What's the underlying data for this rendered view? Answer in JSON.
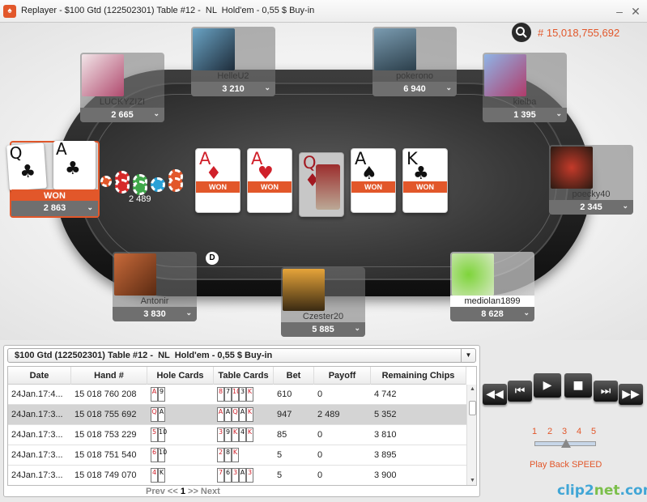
{
  "window": {
    "title": "Replayer - $100 Gtd (122502301) Table #12 -  NL  Hold'em - 0,55 $ Buy-in"
  },
  "hand_number": "# 15,018,755,692",
  "pot": "2 489",
  "dealer_button": "D",
  "colors": {
    "accent": "#e2572a",
    "won": "#e2572a"
  },
  "players": [
    {
      "name": "HelleU2",
      "stack": "3 210"
    },
    {
      "name": "pokerono",
      "stack": "6 940"
    },
    {
      "name": "LUCKYZIZI",
      "stack": "2 665"
    },
    {
      "name": "kielba",
      "stack": "1 395"
    },
    {
      "name": "poecky40",
      "stack": "2 345"
    },
    {
      "name": "Antonir",
      "stack": "3 830"
    },
    {
      "name": "Czester20",
      "stack": "5 885"
    },
    {
      "name": "mediolan1899",
      "stack": "8 628"
    }
  ],
  "winner": {
    "status": "WON",
    "stack": "2 863",
    "cards": [
      {
        "rank": "Q",
        "suit": "♣"
      },
      {
        "rank": "A",
        "suit": "♣"
      }
    ]
  },
  "board": [
    {
      "rank": "A",
      "suit": "♦",
      "won": "WON"
    },
    {
      "rank": "A",
      "suit": "♥",
      "won": "WON"
    },
    {
      "rank": "Q",
      "suit": "♦",
      "won": ""
    },
    {
      "rank": "A",
      "suit": "♠",
      "won": "WON"
    },
    {
      "rank": "K",
      "suit": "♣",
      "won": "WON"
    }
  ],
  "hand_list": {
    "selector": "$100 Gtd (122502301) Table #12 -  NL  Hold'em - 0,55 $ Buy-in",
    "columns": [
      "Date",
      "Hand #",
      "Hole Cards",
      "Table Cards",
      "Bet",
      "Payoff",
      "Remaining Chips"
    ],
    "rows": [
      {
        "date": "24Jan.17:4...",
        "hand": "15 018 760 208",
        "hole": [
          "A",
          "9"
        ],
        "table": [
          "8",
          "7",
          "10",
          "3",
          "K"
        ],
        "bet": "610",
        "payoff": "0",
        "remaining": "4 742"
      },
      {
        "date": "24Jan.17:3...",
        "hand": "15 018 755 692",
        "hole": [
          "Q",
          "A"
        ],
        "table": [
          "A",
          "A",
          "Q",
          "A",
          "K"
        ],
        "bet": "947",
        "payoff": "2 489",
        "remaining": "5 352"
      },
      {
        "date": "24Jan.17:3...",
        "hand": "15 018 753 229",
        "hole": [
          "5",
          "10"
        ],
        "table": [
          "3",
          "9",
          "K",
          "4",
          "K"
        ],
        "bet": "85",
        "payoff": "0",
        "remaining": "3 810"
      },
      {
        "date": "24Jan.17:3...",
        "hand": "15 018 751 540",
        "hole": [
          "6",
          "10"
        ],
        "table": [
          "2",
          "8",
          "K"
        ],
        "bet": "5",
        "payoff": "0",
        "remaining": "3 895"
      },
      {
        "date": "24Jan.17:3...",
        "hand": "15 018 749 070",
        "hole": [
          "4",
          "K"
        ],
        "table": [
          "7",
          "6",
          "3",
          "A",
          "3"
        ],
        "bet": "5",
        "payoff": "0",
        "remaining": "3 900"
      }
    ],
    "pager": {
      "prev": "Prev <<",
      "page": "1",
      "next": ">> Next"
    }
  },
  "controls": {
    "speed_values": [
      "1",
      "2",
      "3",
      "4",
      "5"
    ],
    "speed_label": "Play Back SPEED",
    "speed_level": 3
  },
  "watermark": {
    "a": "clip2",
    "b": "net",
    "c": ".com"
  }
}
